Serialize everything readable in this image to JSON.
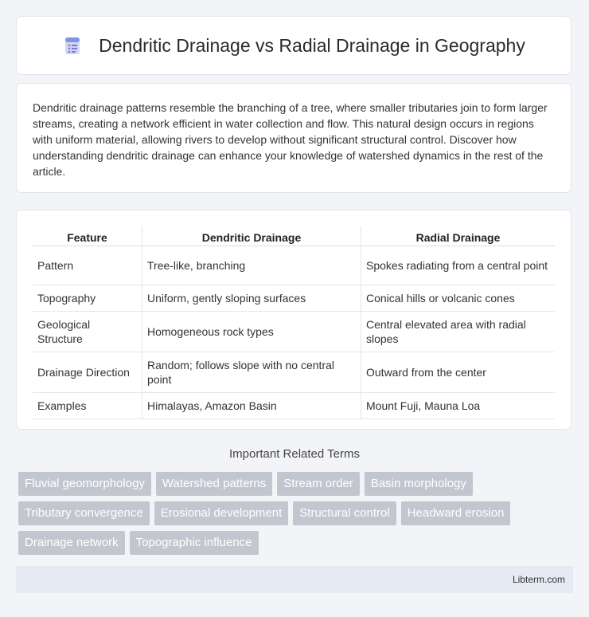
{
  "header": {
    "title": "Dendritic Drainage vs Radial Drainage in Geography",
    "icon": "document-icon"
  },
  "intro": {
    "text": "Dendritic drainage patterns resemble the branching of a tree, where smaller tributaries join to form larger streams, creating a network efficient in water collection and flow. This natural design occurs in regions with uniform material, allowing rivers to develop without significant structural control. Discover how understanding dendritic drainage can enhance your knowledge of watershed dynamics in the rest of the article."
  },
  "table": {
    "headers": [
      "Feature",
      "Dendritic Drainage",
      "Radial Drainage"
    ],
    "rows": [
      [
        "Pattern",
        "Tree-like, branching",
        "Spokes radiating from a central point"
      ],
      [
        "Topography",
        "Uniform, gently sloping surfaces",
        "Conical hills or volcanic cones"
      ],
      [
        "Geological Structure",
        "Homogeneous rock types",
        "Central elevated area with radial slopes"
      ],
      [
        "Drainage Direction",
        "Random; follows slope with no central point",
        "Outward from the center"
      ],
      [
        "Examples",
        "Himalayas, Amazon Basin",
        "Mount Fuji, Mauna Loa"
      ]
    ]
  },
  "related": {
    "title": "Important Related Terms",
    "tags": [
      "Fluvial geomorphology",
      "Watershed patterns",
      "Stream order",
      "Basin morphology",
      "Tributary convergence",
      "Erosional development",
      "Structural control",
      "Headward erosion",
      "Drainage network",
      "Topographic influence"
    ]
  },
  "footer": {
    "site": "Libterm.com"
  }
}
